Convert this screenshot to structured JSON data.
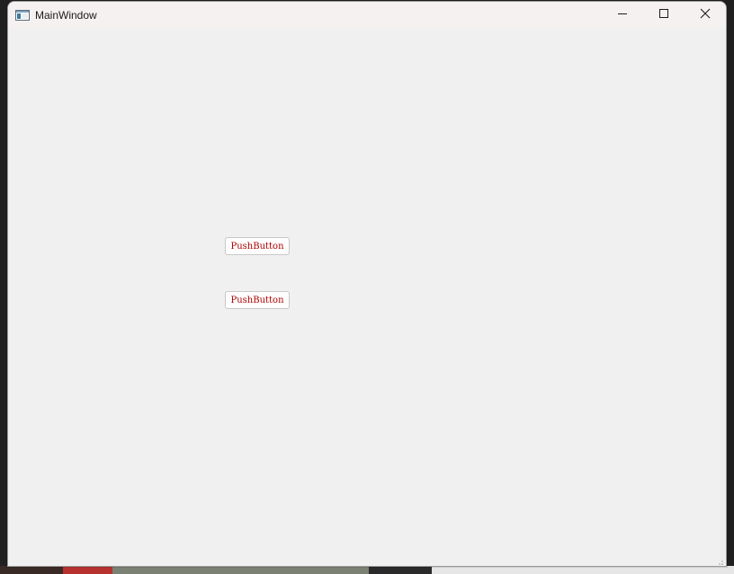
{
  "window": {
    "title": "MainWindow",
    "controls": {
      "minimize_icon": "minimize-icon",
      "maximize_icon": "maximize-icon",
      "close_icon": "close-icon"
    }
  },
  "buttons": [
    {
      "label": "PushButton",
      "text_color": "#b00000"
    },
    {
      "label": "PushButton",
      "text_color": "#b00000"
    }
  ],
  "colors": {
    "client_bg": "#f0f0f0",
    "titlebar_bg": "#f6f1f1",
    "button_text": "#b00000"
  }
}
